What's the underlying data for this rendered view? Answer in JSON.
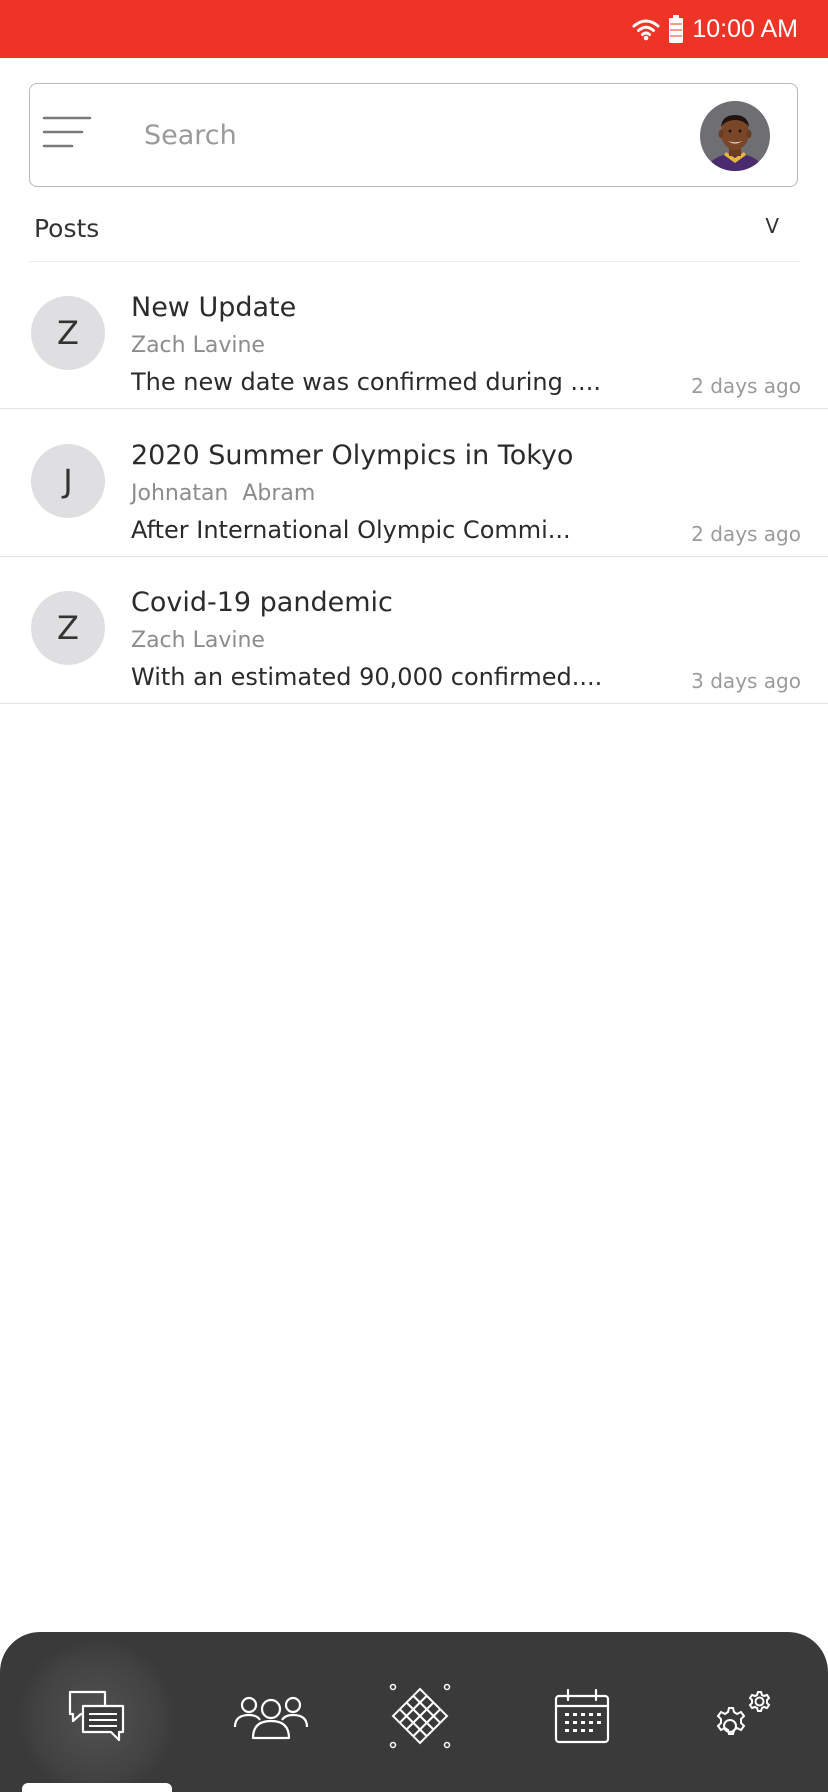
{
  "status_bar": {
    "time": "10:00 AM",
    "background": "#ee3427",
    "icons": [
      "wifi-icon",
      "battery-icon"
    ]
  },
  "search": {
    "placeholder": "Search",
    "value": ""
  },
  "posts_section": {
    "title": "Posts",
    "chevron": "V"
  },
  "posts": [
    {
      "initial": "Z",
      "title": "New Update",
      "author": "Zach Lavine",
      "snippet": "The new date was confirmed during ....",
      "time": "2 days ago"
    },
    {
      "initial": "J",
      "title": "2020 Summer Olympics in Tokyo",
      "author": "Johnatan  Abram",
      "snippet": "After International Olympic Commi...",
      "time": "2 days ago"
    },
    {
      "initial": "Z",
      "title": "Covid-19 pandemic",
      "author": "Zach Lavine",
      "snippet": "With an estimated 90,000 confirmed....",
      "time": "3 days ago"
    }
  ],
  "bottom_nav": {
    "background": "#3a3a3b",
    "active_item": "chat",
    "items": [
      "chat-icon",
      "group-icon",
      "grid-diamond-icon",
      "calendar-icon",
      "settings-gears-icon"
    ]
  }
}
